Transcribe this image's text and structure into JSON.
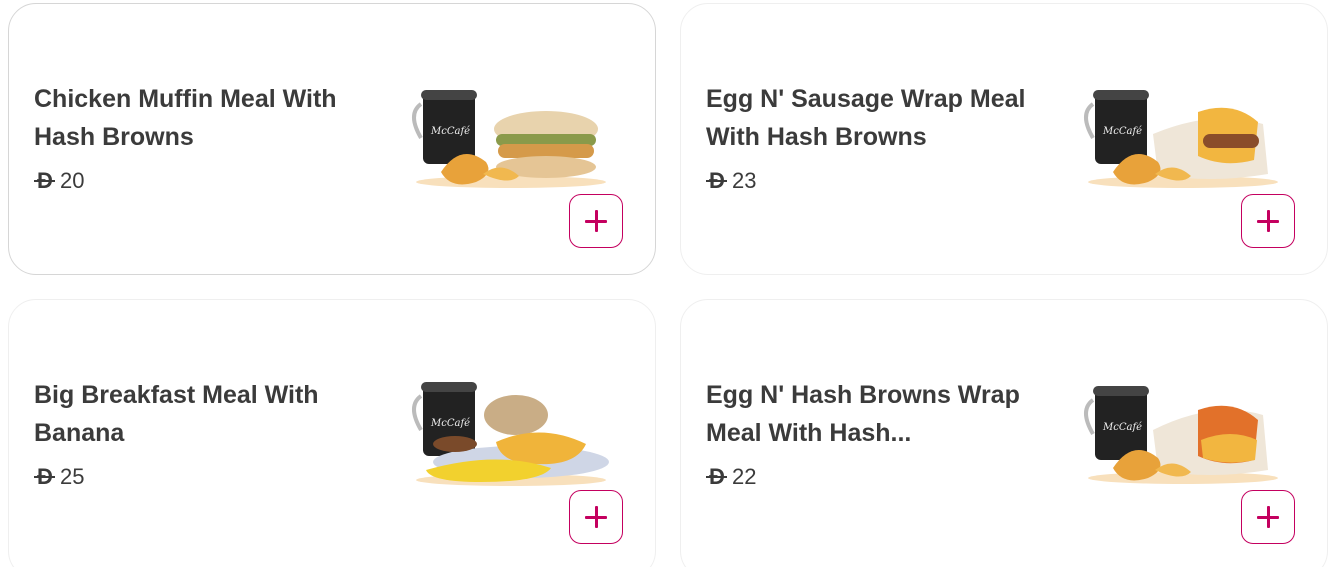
{
  "currency_symbol": "Đ",
  "accent_color": "#c4005f",
  "items": [
    {
      "name": "Chicken Muffin Meal With Hash Browns",
      "price": "20",
      "image": "chicken-muffin-meal-image",
      "add_icon": "plus-icon"
    },
    {
      "name": "Egg N' Sausage Wrap Meal With Hash Browns",
      "price": "23",
      "image": "egg-sausage-wrap-meal-image",
      "add_icon": "plus-icon"
    },
    {
      "name": "Big Breakfast Meal With Banana",
      "price": "25",
      "image": "big-breakfast-meal-image",
      "add_icon": "plus-icon"
    },
    {
      "name": "Egg N' Hash Browns Wrap Meal With Hash...",
      "price": "22",
      "image": "egg-hash-browns-wrap-meal-image",
      "add_icon": "plus-icon"
    }
  ]
}
